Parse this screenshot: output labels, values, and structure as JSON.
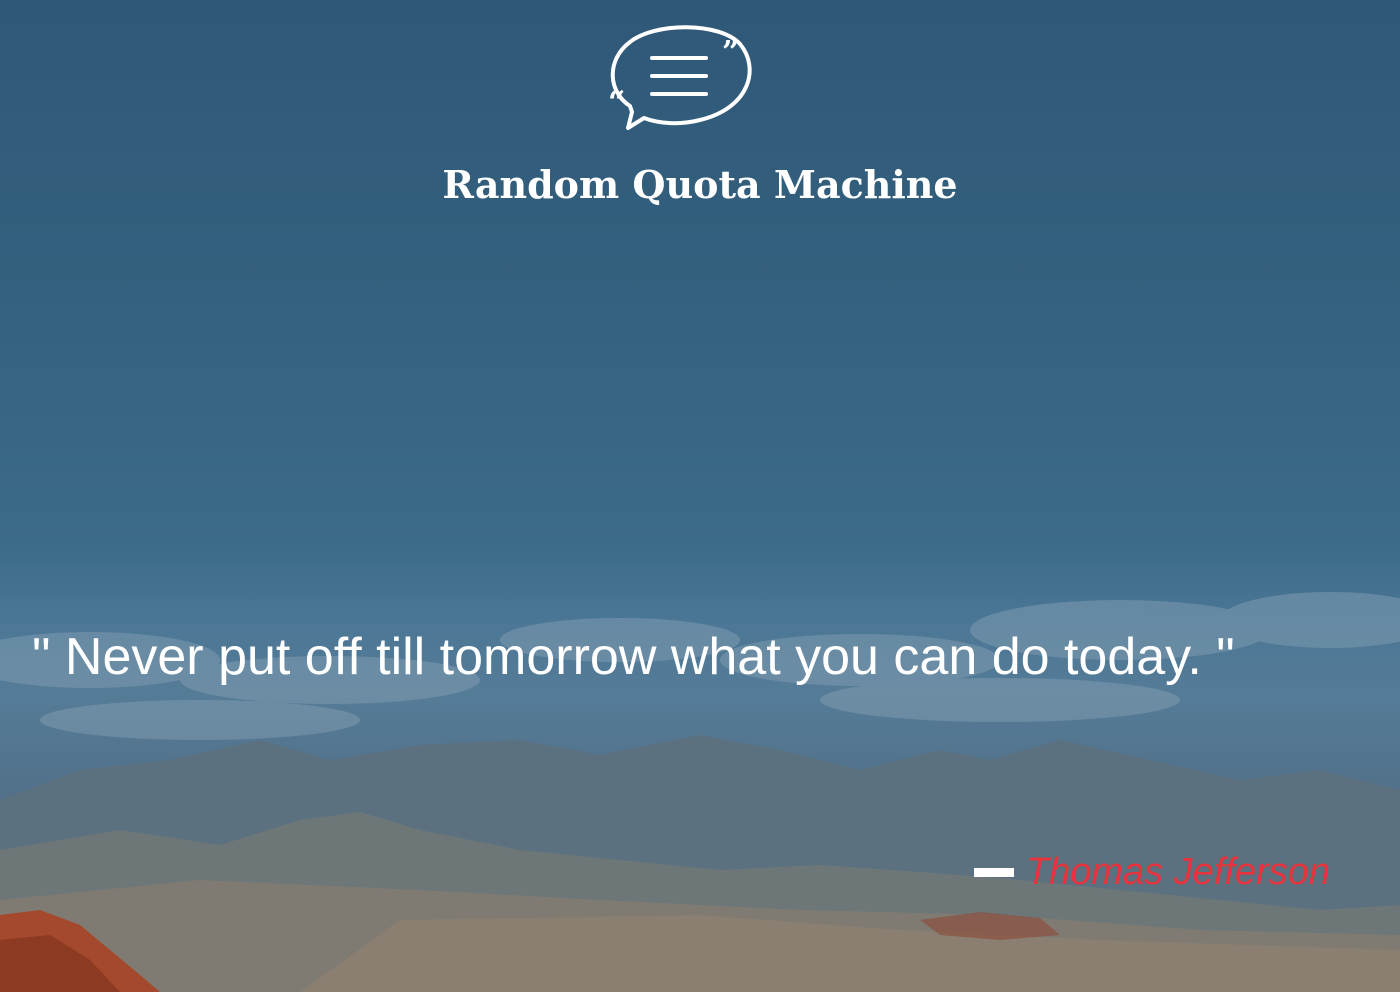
{
  "app": {
    "title": "Random Quota Machine",
    "logo_icon": "quote-speech-bubble-icon"
  },
  "quote": {
    "text": "\" Never put off till tomorrow what you can do today. \"",
    "author": "Thomas Jefferson"
  },
  "colors": {
    "author": "#e8323c",
    "text": "#ffffff",
    "sky": "#34617f"
  }
}
